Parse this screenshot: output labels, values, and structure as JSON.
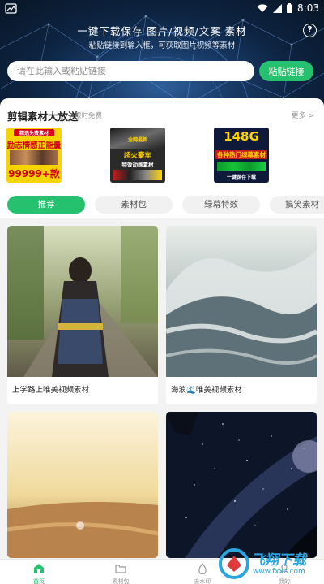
{
  "status_bar": {
    "time": "8:03"
  },
  "header": {
    "title": "一键下载保存 图片/视频/文案 素材",
    "subtitle": "粘贴链接到输入框，可获取图片视频等素材",
    "help_label": "?"
  },
  "search": {
    "placeholder": "请在此输入或粘贴链接",
    "paste_button": "粘贴链接"
  },
  "materials": {
    "title": "剪辑素材大放送",
    "badge": "限时免费",
    "more": "更多 >",
    "items": [
      {
        "top_text": "精选免费素材",
        "main_text": "励志情感正能量",
        "count_text": "99999+款",
        "colors": {
          "bg": "#f5d400",
          "text": "#d6001c"
        }
      },
      {
        "top_text": "全网最新",
        "main_text": "超火豪车",
        "sub_text": "特效动画素材",
        "colors": {
          "bg": "#2a2a2a",
          "text": "#ffd400"
        }
      },
      {
        "top_text": "148G",
        "main_text": "各种热门绿幕素材",
        "sub_text": "一键保存下载",
        "colors": {
          "bg": "#0f1a3a",
          "text": "#ffd400"
        }
      }
    ]
  },
  "tabs": [
    "推荐",
    "素材包",
    "绿幕特效",
    "搞笑素材"
  ],
  "feed": [
    {
      "caption": "上学路上唯美视频素材"
    },
    {
      "caption": "海浪🌊唯美视频素材"
    },
    {
      "caption": ""
    },
    {
      "caption": ""
    }
  ],
  "bottom_nav": [
    {
      "label": "首页",
      "icon": "home-icon"
    },
    {
      "label": "素材包",
      "icon": "folder-icon"
    },
    {
      "label": "去水印",
      "icon": "drop-icon"
    },
    {
      "label": "我的",
      "icon": "user-icon"
    }
  ],
  "watermark": {
    "text": "飞翔下载",
    "sub": "www.fxxz.com"
  },
  "colors": {
    "accent": "#25c16f",
    "header_dark": "#0d2340"
  }
}
